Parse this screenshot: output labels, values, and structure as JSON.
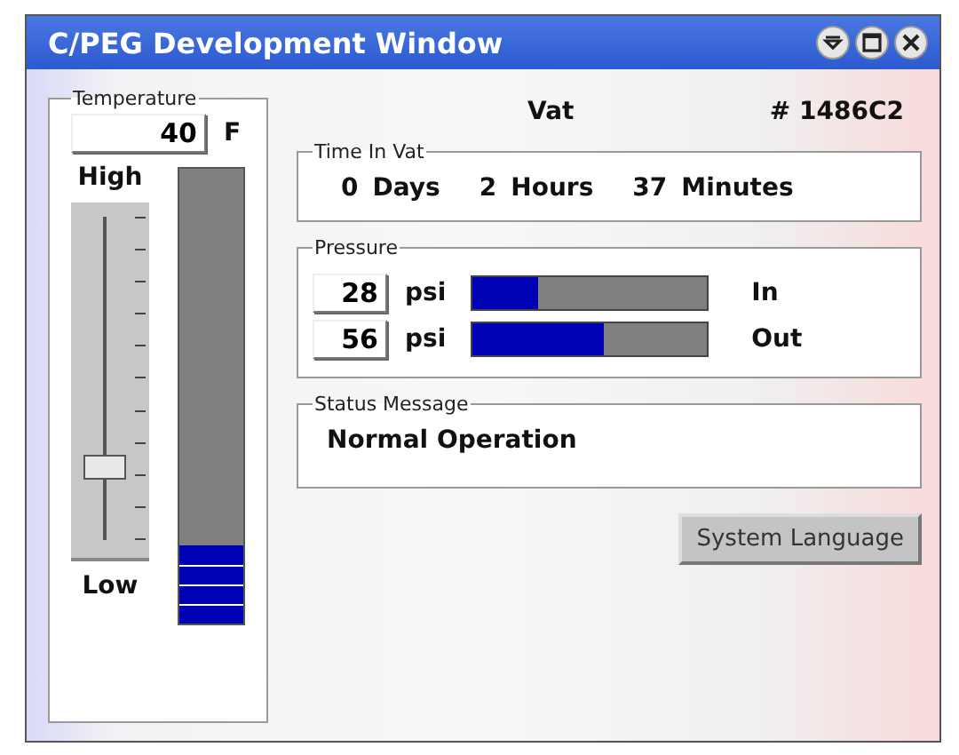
{
  "window": {
    "title": "C/PEG Development Window"
  },
  "temperature": {
    "label": "Temperature",
    "value": "40",
    "unit": "F",
    "high_label": "High",
    "low_label": "Low",
    "slider": {
      "level": 0.2
    },
    "meter": {
      "level": 0.17
    }
  },
  "vat": {
    "label": "Vat",
    "number": "# 1486C2"
  },
  "time_in_vat": {
    "label": "Time In Vat",
    "days": "0",
    "days_unit": "Days",
    "hours": "2",
    "hours_unit": "Hours",
    "minutes": "37",
    "minutes_unit": "Minutes"
  },
  "pressure": {
    "label": "Pressure",
    "rows": [
      {
        "value": "28",
        "unit": "psi",
        "level": 0.28,
        "direction": "In"
      },
      {
        "value": "56",
        "unit": "psi",
        "level": 0.56,
        "direction": "Out"
      }
    ]
  },
  "status": {
    "label": "Status Message",
    "message": "Normal Operation"
  },
  "buttons": [
    "System Language"
  ]
}
